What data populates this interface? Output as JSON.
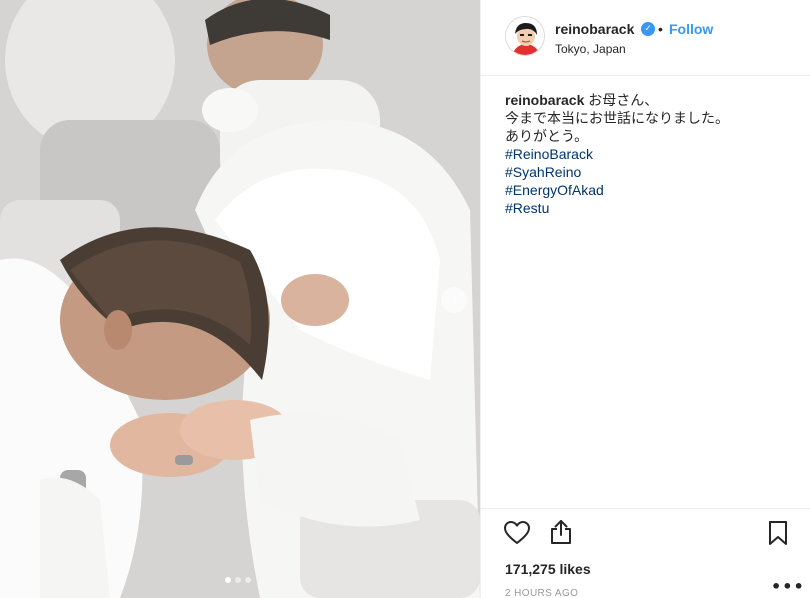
{
  "post": {
    "username": "reinobarack",
    "verified_symbol": "✓",
    "separator": "•",
    "follow_label": "Follow",
    "location": "Tokyo, Japan",
    "caption": {
      "user": "reinobarack",
      "lines": [
        "お母さん、",
        "今まで本当にお世話になりました。",
        "ありがとう。"
      ],
      "hashtags": [
        "#ReinoBarack",
        "#SyahReino",
        "#EnergyOfAkad",
        "#Restu"
      ]
    },
    "likes": "171,275 likes",
    "timestamp": "2 HOURS AGO",
    "more_label": "•••"
  },
  "carousel": {
    "next_symbol": "›",
    "slide_count": 3,
    "active_slide": 1
  },
  "colors": {
    "accent": "#3897f0",
    "hashtag": "#003569",
    "text": "#262626",
    "muted": "#999999",
    "border": "#efefef"
  },
  "icons": {
    "like": "heart-icon",
    "share": "share-icon",
    "save": "bookmark-icon",
    "more": "more-options-icon",
    "verified": "verified-badge-icon",
    "next": "chevron-right-icon"
  }
}
